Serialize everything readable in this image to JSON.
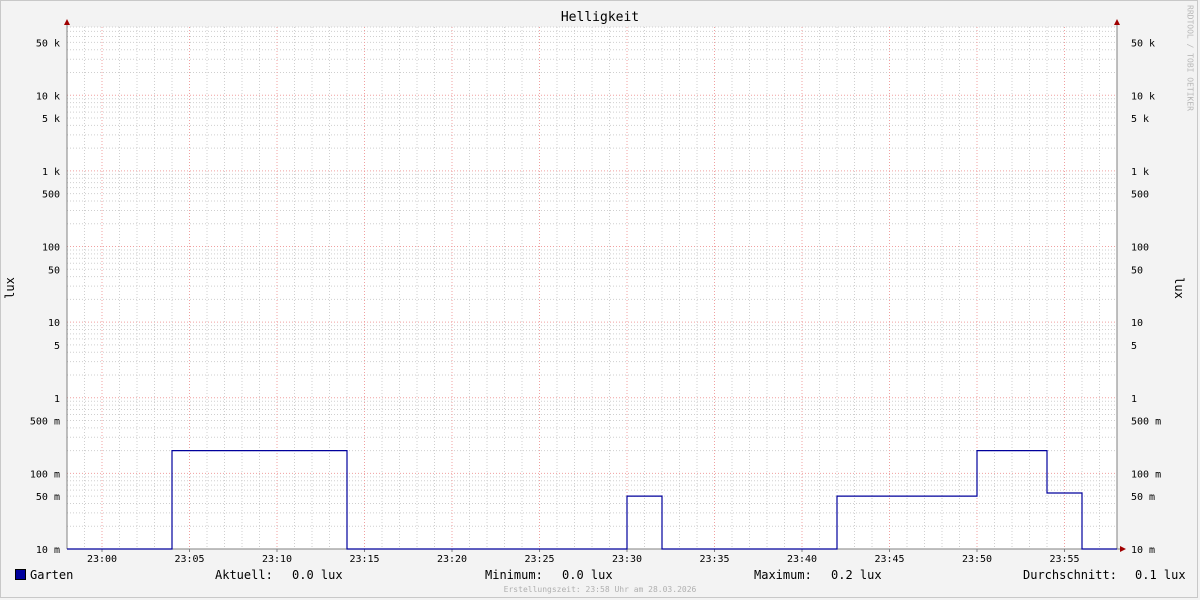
{
  "chart_data": {
    "type": "line",
    "title": "Helligkeit",
    "ylabel": "lux",
    "xlabel": "",
    "yscale": "log",
    "ylim": [
      0.01,
      80000
    ],
    "xlim_minutes": [
      "22:58",
      "23:58"
    ],
    "x_ticks": [
      "23:00",
      "23:05",
      "23:10",
      "23:15",
      "23:20",
      "23:25",
      "23:30",
      "23:35",
      "23:40",
      "23:45",
      "23:50",
      "23:55"
    ],
    "y_ticks": [
      {
        "value": 50000,
        "label": "50 k"
      },
      {
        "value": 10000,
        "label": "10 k"
      },
      {
        "value": 5000,
        "label": "5 k"
      },
      {
        "value": 1000,
        "label": "1 k"
      },
      {
        "value": 500,
        "label": "500"
      },
      {
        "value": 100,
        "label": "100"
      },
      {
        "value": 50,
        "label": "50"
      },
      {
        "value": 10,
        "label": "10"
      },
      {
        "value": 5,
        "label": "5"
      },
      {
        "value": 1,
        "label": "1"
      },
      {
        "value": 0.5,
        "label": "500 m"
      },
      {
        "value": 0.1,
        "label": "100 m"
      },
      {
        "value": 0.05,
        "label": "50 m"
      },
      {
        "value": 0.01,
        "label": "10 m"
      }
    ],
    "series": [
      {
        "name": "Garten",
        "color": "#00009c",
        "x": [
          "22:58",
          "23:04",
          "23:04",
          "23:14",
          "23:14",
          "23:30",
          "23:30",
          "23:32",
          "23:32",
          "23:42",
          "23:42",
          "23:50",
          "23:50",
          "23:54",
          "23:54",
          "23:56",
          "23:56",
          "23:58"
        ],
        "y": [
          0.01,
          0.01,
          0.2,
          0.2,
          0.01,
          0.01,
          0.05,
          0.05,
          0.01,
          0.01,
          0.05,
          0.05,
          0.2,
          0.2,
          0.055,
          0.055,
          0.01,
          0.01
        ]
      }
    ],
    "grid": true,
    "legend_placement": "bottom-left"
  },
  "legend": {
    "series_name": "Garten",
    "current_label": "Aktuell:",
    "current_value": "0.0 lux",
    "min_label": "Minimum:",
    "min_value": "0.0 lux",
    "max_label": "Maximum:",
    "max_value": "0.2 lux",
    "avg_label": "Durchschnitt:",
    "avg_value": "0.1 lux"
  },
  "watermark": "RRDTOOL / TOBI OETIKER",
  "footer": "Erstellungszeit: 23:58 Uhr am 28.03.2026",
  "colors": {
    "series": "#00009c",
    "major_grid": "#f0a0a0",
    "minor_grid": "#cfcfcf",
    "axis_arrow": "#a00000"
  }
}
